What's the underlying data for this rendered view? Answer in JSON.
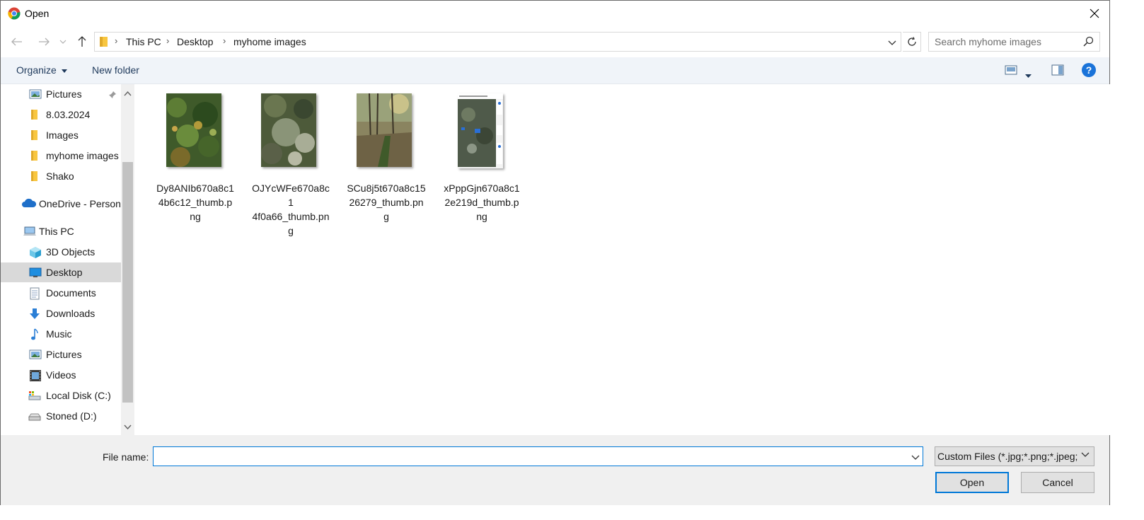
{
  "window": {
    "title": "Open"
  },
  "address": {
    "breadcrumbs": [
      "This PC",
      "Desktop",
      "myhome images"
    ]
  },
  "search": {
    "placeholder": "Search myhome images"
  },
  "toolbar": {
    "organize_label": "Organize",
    "new_folder_label": "New folder"
  },
  "sidebar": {
    "items": [
      {
        "label": "Pictures",
        "icon": "pictures-icon",
        "pinned": true
      },
      {
        "label": "8.03.2024",
        "icon": "folder-icon"
      },
      {
        "label": "Images",
        "icon": "folder-icon"
      },
      {
        "label": "myhome images",
        "icon": "folder-icon"
      },
      {
        "label": "Shako",
        "icon": "folder-icon"
      },
      {
        "label": "OneDrive - Person",
        "icon": "onedrive-icon"
      },
      {
        "label": "This PC",
        "icon": "computer-icon"
      },
      {
        "label": "3D Objects",
        "icon": "3d-objects-icon"
      },
      {
        "label": "Desktop",
        "icon": "desktop-icon",
        "selected": true
      },
      {
        "label": "Documents",
        "icon": "documents-icon"
      },
      {
        "label": "Downloads",
        "icon": "downloads-icon"
      },
      {
        "label": "Music",
        "icon": "music-icon"
      },
      {
        "label": "Pictures",
        "icon": "pictures-icon"
      },
      {
        "label": "Videos",
        "icon": "videos-icon"
      },
      {
        "label": "Local Disk (C:)",
        "icon": "local-disk-icon"
      },
      {
        "label": "Stoned (D:)",
        "icon": "drive-icon"
      }
    ]
  },
  "files": [
    {
      "name": "Dy8ANIb670a8c14b6c12_thumb.png",
      "line1": "Dy8ANIb670a8c1",
      "line2": "4b6c12_thumb.p",
      "line3": "ng"
    },
    {
      "name": "OJYcWFe670a8c14f0a66_thumb.png",
      "line1": "OJYcWFe670a8c1",
      "line2": "4f0a66_thumb.pn",
      "line3": "g"
    },
    {
      "name": "SCu8j5t670a8c1526279_thumb.png",
      "line1": "SCu8j5t670a8c15",
      "line2": "26279_thumb.pn",
      "line3": "g"
    },
    {
      "name": "xPppGjn670a8c12e219d_thumb.png",
      "line1": "xPppGjn670a8c1",
      "line2": "2e219d_thumb.p",
      "line3": "ng"
    }
  ],
  "footer": {
    "file_name_label": "File name:",
    "file_name_value": "",
    "filter_value": "Custom Files (*.jpg;*.png;*.jpeg;",
    "open_label": "Open",
    "cancel_label": "Cancel"
  },
  "colors": {
    "accent": "#0078d7",
    "toolbar_bg": "#f0f4f9",
    "selected_bg": "#d9d9d9",
    "folder": "#f8c640"
  }
}
